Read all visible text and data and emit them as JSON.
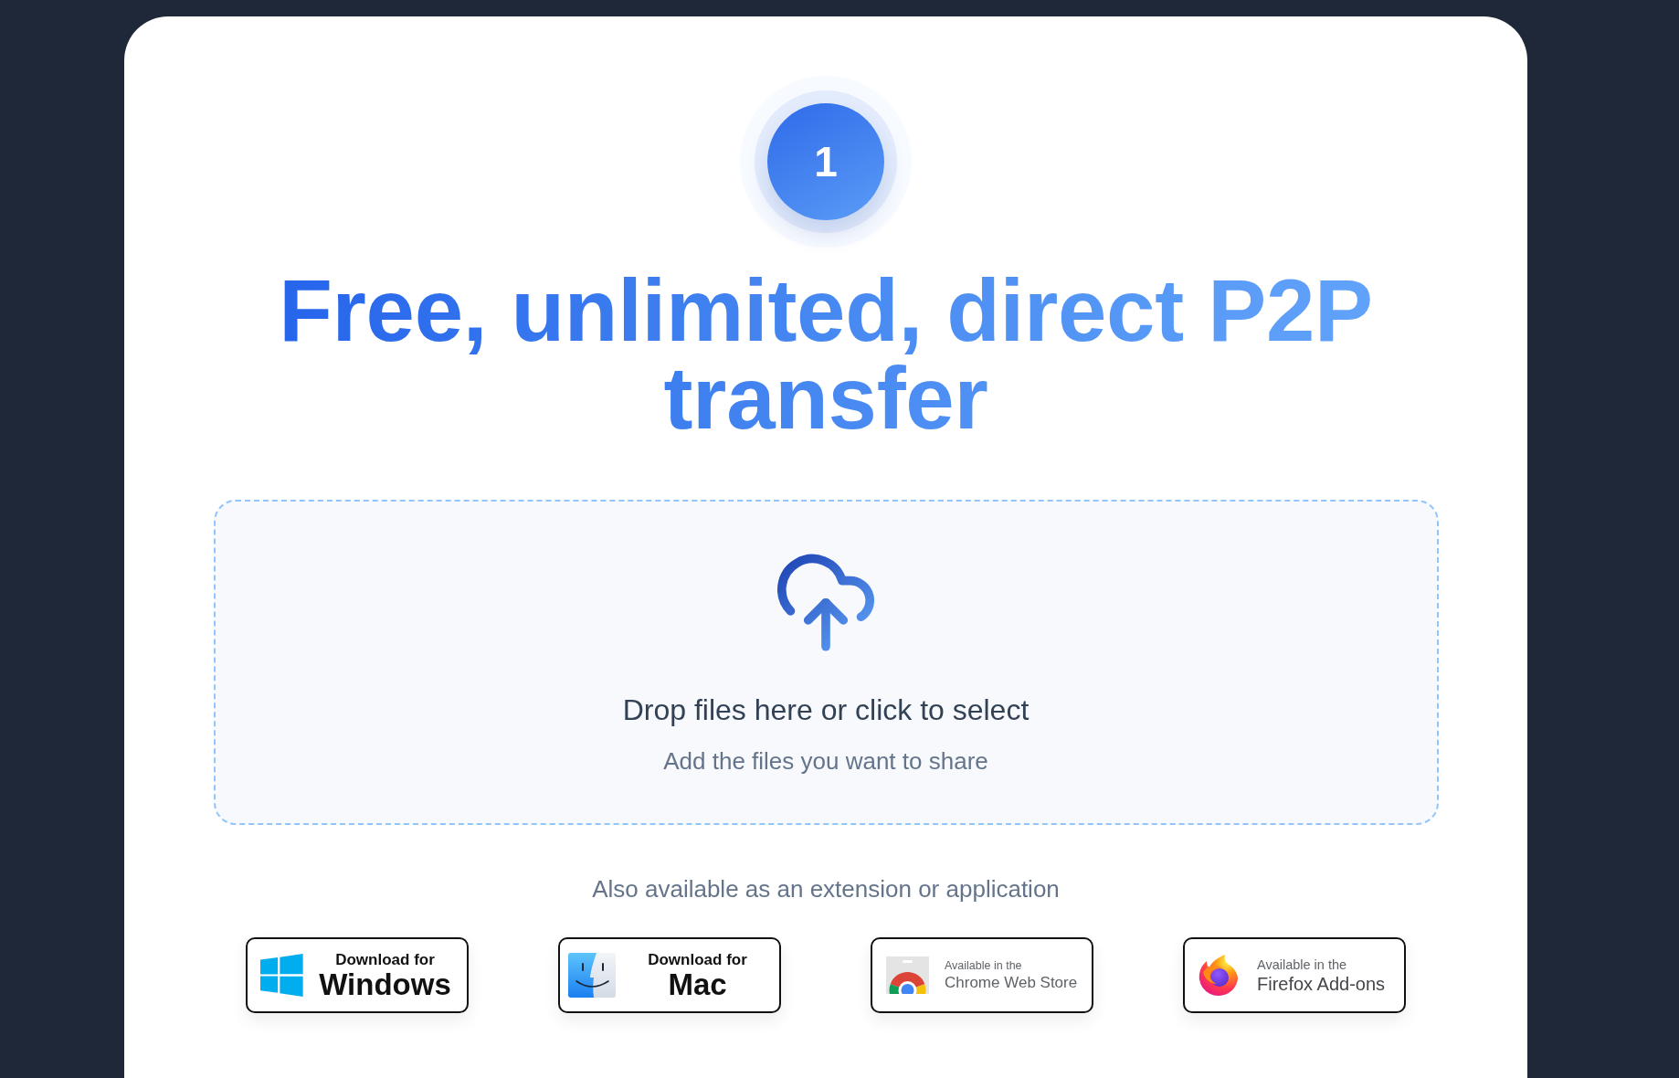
{
  "step": {
    "number": "1"
  },
  "headline": "Free, unlimited, direct P2P transfer",
  "drop_zone": {
    "title": "Drop files here or click to select",
    "hint": "Add the files you want to share"
  },
  "apps": {
    "caption": "Also available as an extension or application",
    "badges": [
      {
        "kind": "windows",
        "top_line": "Download for",
        "main_line": "Windows"
      },
      {
        "kind": "mac",
        "top_line": "Download for",
        "main_line": "Mac"
      },
      {
        "kind": "chrome",
        "top_line": "Available in the",
        "main_line": "Chrome Web Store"
      },
      {
        "kind": "firefox",
        "top_line": "Available in the",
        "main_line": "Firefox Add-ons"
      }
    ]
  }
}
